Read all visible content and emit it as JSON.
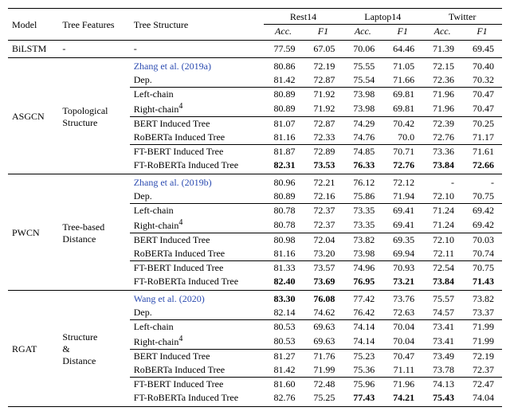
{
  "chart_data": {
    "type": "table",
    "title": "",
    "columns_top": [
      "Model",
      "Tree Features",
      "Tree Structure",
      "Rest14",
      "Laptop14",
      "Twitter"
    ],
    "columns_sub": [
      "Acc.",
      "F1",
      "Acc.",
      "F1",
      "Acc.",
      "F1"
    ]
  },
  "head": {
    "model": "Model",
    "features": "Tree Features",
    "structure": "Tree Structure",
    "ds1": "Rest14",
    "ds2": "Laptop14",
    "ds3": "Twitter",
    "acc": "Acc.",
    "f1": "F1"
  },
  "bilstm": {
    "model": "BiLSTM",
    "features": "-",
    "structure": "-",
    "v": [
      "77.59",
      "67.05",
      "70.06",
      "64.46",
      "71.39",
      "69.45"
    ]
  },
  "asgcn": {
    "model": "ASGCN",
    "features": "Topological Structure",
    "rows": [
      {
        "structure": "Zhang et al. (2019a)",
        "cite": true,
        "v": [
          "80.86",
          "72.19",
          "75.55",
          "71.05",
          "72.15",
          "70.40"
        ]
      },
      {
        "structure": "Dep.",
        "v": [
          "81.42",
          "72.87",
          "75.54",
          "71.66",
          "72.36",
          "70.32"
        ]
      },
      {
        "sep": true,
        "structure": "Left-chain",
        "v": [
          "80.89",
          "71.92",
          "73.98",
          "69.81",
          "71.96",
          "70.47"
        ]
      },
      {
        "structure": "Right-chain",
        "sup": "4",
        "v": [
          "80.89",
          "71.92",
          "73.98",
          "69.81",
          "71.96",
          "70.47"
        ]
      },
      {
        "sep": true,
        "structure": "BERT Induced Tree",
        "v": [
          "81.07",
          "72.87",
          "74.29",
          "70.42",
          "72.39",
          "70.25"
        ]
      },
      {
        "structure": "RoBERTa Induced Tree",
        "v": [
          "81.16",
          "72.33",
          "74.76",
          "70.0",
          "72.76",
          "71.17"
        ]
      },
      {
        "sep": true,
        "structure": "FT-BERT Induced Tree",
        "v": [
          "81.87",
          "72.89",
          "74.85",
          "70.71",
          "73.36",
          "71.61"
        ]
      },
      {
        "structure": "FT-RoBERTa Induced Tree",
        "bold": true,
        "v": [
          "82.31",
          "73.53",
          "76.33",
          "72.76",
          "73.84",
          "72.66"
        ]
      }
    ]
  },
  "pwcn": {
    "model": "PWCN",
    "features": "Tree-based Distance",
    "rows": [
      {
        "structure": "Zhang et al. (2019b)",
        "cite": true,
        "v": [
          "80.96",
          "72.21",
          "76.12",
          "72.12",
          "-",
          "-"
        ]
      },
      {
        "structure": "Dep.",
        "v": [
          "80.89",
          "72.16",
          "75.86",
          "71.94",
          "72.10",
          "70.75"
        ]
      },
      {
        "sep": true,
        "structure": "Left-chain",
        "v": [
          "80.78",
          "72.37",
          "73.35",
          "69.41",
          "71.24",
          "69.42"
        ]
      },
      {
        "structure": "Right-chain",
        "sup": "4",
        "v": [
          "80.78",
          "72.37",
          "73.35",
          "69.41",
          "71.24",
          "69.42"
        ]
      },
      {
        "sep": true,
        "structure": "BERT Induced Tree",
        "v": [
          "80.98",
          "72.04",
          "73.82",
          "69.35",
          "72.10",
          "70.03"
        ]
      },
      {
        "structure": "RoBERTa Induced Tree",
        "v": [
          "81.16",
          "73.20",
          "73.98",
          "69.94",
          "72.11",
          "70.74"
        ]
      },
      {
        "sep": true,
        "structure": "FT-BERT Induced Tree",
        "v": [
          "81.33",
          "73.57",
          "74.96",
          "70.93",
          "72.54",
          "70.75"
        ]
      },
      {
        "structure": "FT-RoBERTa Induced Tree",
        "bold": true,
        "v": [
          "82.40",
          "73.69",
          "76.95",
          "73.21",
          "73.84",
          "71.43"
        ]
      }
    ]
  },
  "rgat": {
    "model": "RGAT",
    "features": "Structure & Distance",
    "features_lines": [
      "Structure",
      "&",
      "Distance"
    ],
    "rows": [
      {
        "structure": "Wang et al. (2020)",
        "cite": true,
        "boldcols": [
          0,
          1,
          6
        ],
        "v": [
          "83.30",
          "76.08",
          "77.42",
          "73.76",
          "75.57",
          "73.82"
        ]
      },
      {
        "structure": "Dep.",
        "v": [
          "82.14",
          "74.62",
          "76.42",
          "72.63",
          "74.57",
          "73.37"
        ]
      },
      {
        "sep": true,
        "structure": "Left-chain",
        "v": [
          "80.53",
          "69.63",
          "74.14",
          "70.04",
          "73.41",
          "71.99"
        ]
      },
      {
        "structure": "Right-chain",
        "sup": "4",
        "v": [
          "80.53",
          "69.63",
          "74.14",
          "70.04",
          "73.41",
          "71.99"
        ]
      },
      {
        "sep": true,
        "structure": "BERT Induced Tree",
        "v": [
          "81.27",
          "71.76",
          "75.23",
          "70.47",
          "73.49",
          "72.19"
        ]
      },
      {
        "structure": "RoBERTa Induced Tree",
        "v": [
          "81.42",
          "71.99",
          "75.36",
          "71.11",
          "73.78",
          "72.37"
        ]
      },
      {
        "sep": true,
        "structure": "FT-BERT Induced Tree",
        "v": [
          "81.60",
          "72.48",
          "75.96",
          "71.96",
          "74.13",
          "72.47"
        ]
      },
      {
        "structure": "FT-RoBERTa Induced Tree",
        "boldcols": [
          2,
          3,
          4,
          7
        ],
        "v": [
          "82.76",
          "75.25",
          "77.43",
          "74.21",
          "75.43",
          "74.04"
        ]
      }
    ]
  }
}
